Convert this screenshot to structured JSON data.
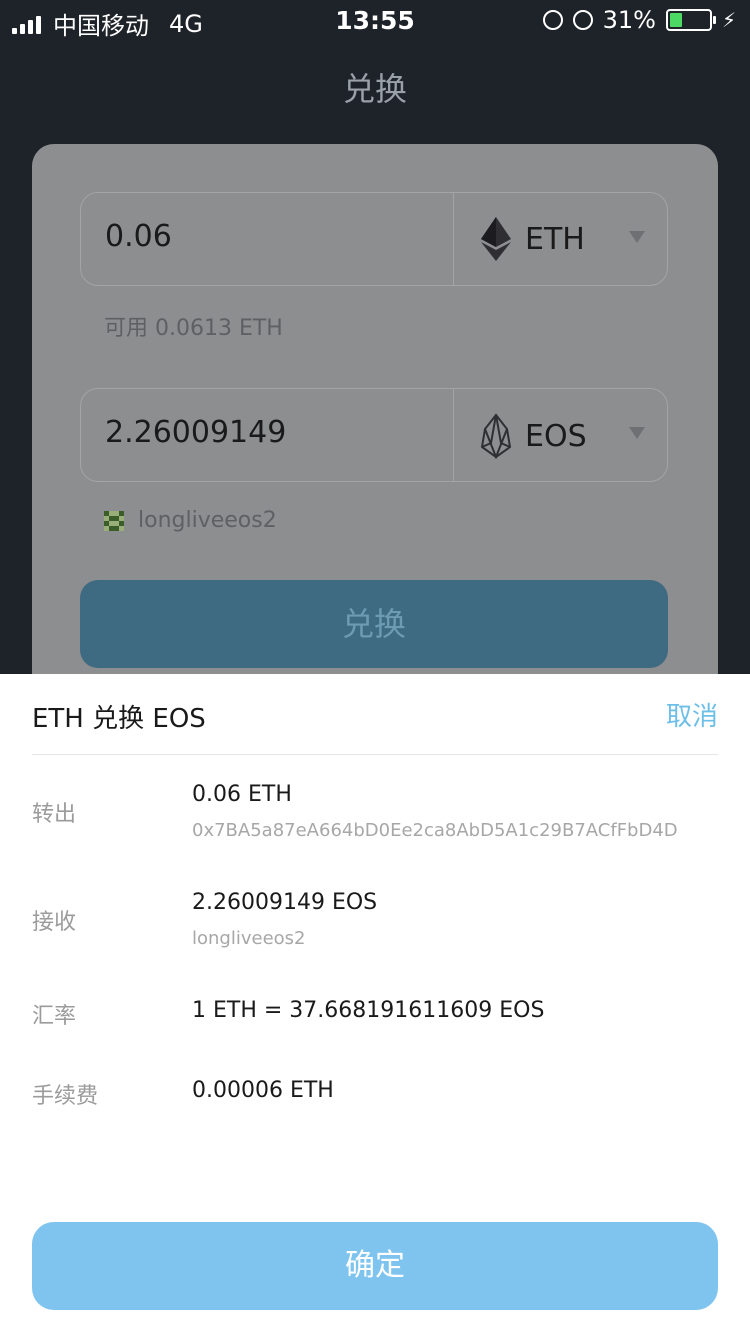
{
  "status": {
    "carrier": "中国移动",
    "network": "4G",
    "time": "13:55",
    "battery": "31%",
    "battery_level": 0.31
  },
  "header": {
    "title": "兑换"
  },
  "from": {
    "amount": "0.06",
    "token": "ETH",
    "available": "可用 0.0613 ETH"
  },
  "to": {
    "amount": "2.26009149",
    "token": "EOS",
    "account": "longliveeos2"
  },
  "exchange_button": "兑换",
  "sheet": {
    "title": "ETH 兑换 EOS",
    "cancel": "取消",
    "out_label": "转出",
    "out_amount": "0.06 ETH",
    "out_address": "0x7BA5a87eA664bD0Ee2ca8AbD5A1c29B7ACfFbD4D",
    "in_label": "接收",
    "in_amount": "2.26009149 EOS",
    "in_account": "longliveeos2",
    "rate_label": "汇率",
    "rate": "1 ETH = 37.668191611609 EOS",
    "fee_label": "手续费",
    "fee": "0.00006 ETH",
    "confirm": "确定"
  },
  "colors": {
    "accent": "#7ec4ef",
    "cancel": "#6ebfe8",
    "dark_bg": "#1e2229"
  }
}
